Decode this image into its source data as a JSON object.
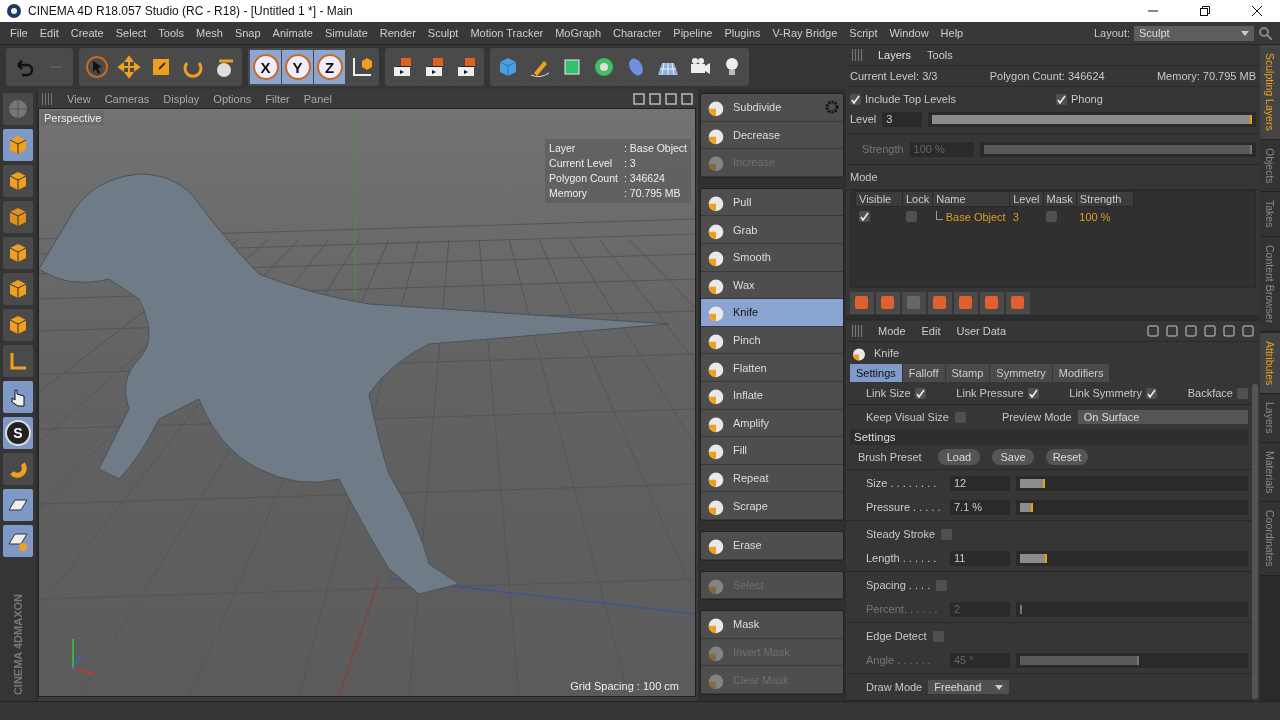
{
  "window": {
    "title": "CINEMA 4D R18.057 Studio (RC - R18) - [Untitled 1 *] - Main"
  },
  "menu": [
    "File",
    "Edit",
    "Create",
    "Select",
    "Tools",
    "Mesh",
    "Snap",
    "Animate",
    "Simulate",
    "Render",
    "Sculpt",
    "Motion Tracker",
    "MoGraph",
    "Character",
    "Pipeline",
    "Plugins",
    "V-Ray Bridge",
    "Script",
    "Window",
    "Help"
  ],
  "layout": {
    "label": "Layout:",
    "value": "Sculpt"
  },
  "axis_buttons": [
    {
      "label": "X",
      "selected": true
    },
    {
      "label": "Y",
      "selected": true
    },
    {
      "label": "Z",
      "selected": true
    }
  ],
  "left_tools": {
    "snap_letter": "S",
    "brand": [
      "MAXON",
      "CINEMA 4D"
    ]
  },
  "viewport": {
    "menu": [
      "View",
      "Cameras",
      "Display",
      "Options",
      "Filter",
      "Panel"
    ],
    "camera": "Perspective",
    "hud": [
      {
        "label": "Layer",
        "value": ": Base Object"
      },
      {
        "label": "Current Level",
        "value": ": 3"
      },
      {
        "label": "Polygon Count",
        "value": ": 346624"
      },
      {
        "label": "Memory",
        "value": ": 70.795 MB"
      }
    ],
    "grid_spacing": "Grid Spacing : 100 cm"
  },
  "palette": [
    [
      {
        "label": "Subdivide",
        "selected": false,
        "disabled": false
      },
      {
        "label": "Decrease",
        "selected": false,
        "disabled": false
      },
      {
        "label": "Increase",
        "selected": false,
        "disabled": true
      }
    ],
    [
      {
        "label": "Pull",
        "selected": false,
        "disabled": false
      },
      {
        "label": "Grab",
        "selected": false,
        "disabled": false
      },
      {
        "label": "Smooth",
        "selected": false,
        "disabled": false
      },
      {
        "label": "Wax",
        "selected": false,
        "disabled": false
      },
      {
        "label": "Knife",
        "selected": true,
        "disabled": false
      },
      {
        "label": "Pinch",
        "selected": false,
        "disabled": false
      },
      {
        "label": "Flatten",
        "selected": false,
        "disabled": false
      },
      {
        "label": "Inflate",
        "selected": false,
        "disabled": false
      },
      {
        "label": "Amplify",
        "selected": false,
        "disabled": false
      },
      {
        "label": "Fill",
        "selected": false,
        "disabled": false
      },
      {
        "label": "Repeat",
        "selected": false,
        "disabled": false
      },
      {
        "label": "Scrape",
        "selected": false,
        "disabled": false
      }
    ],
    [
      {
        "label": "Erase",
        "selected": false,
        "disabled": false
      }
    ],
    [
      {
        "label": "Select",
        "selected": false,
        "disabled": true
      }
    ],
    [
      {
        "label": "Mask",
        "selected": false,
        "disabled": false
      },
      {
        "label": "Invert Mask",
        "selected": false,
        "disabled": true
      },
      {
        "label": "Clear Mask",
        "selected": false,
        "disabled": true
      }
    ]
  ],
  "layers": {
    "tabs": [
      {
        "label": "Layers",
        "selected": true
      },
      {
        "label": "Tools",
        "selected": false
      }
    ],
    "stats": [
      "Current Level: 3/3",
      "Polygon Count: 346624",
      "Memory: 70.795 MB"
    ],
    "options": [
      {
        "label": "Include Top Levels",
        "checked": true
      },
      {
        "label": "Phong",
        "checked": true
      }
    ],
    "level": {
      "label": "Level",
      "value": "3",
      "level": 1.0
    },
    "strength": {
      "label": "Strength",
      "value": "100 %",
      "level": 1.0,
      "disabled": true
    },
    "mode_label": "Mode",
    "columns": [
      "Visible",
      "Lock",
      "Name",
      "Level",
      "Mask",
      "Strength"
    ],
    "rows": [
      {
        "visible": true,
        "lock": false,
        "name": "Base Object",
        "level": "3",
        "mask": false,
        "strength": "100 %"
      }
    ]
  },
  "side_tabs_top": [
    {
      "label": "Sculpting Layers",
      "selected": true
    },
    {
      "label": "Objects",
      "selected": false
    },
    {
      "label": "Takes",
      "selected": false
    },
    {
      "label": "Content Browser",
      "selected": false
    }
  ],
  "side_tabs_bottom": [
    {
      "label": "Attributes",
      "selected": true
    },
    {
      "label": "Layers",
      "selected": false
    },
    {
      "label": "Materials",
      "selected": false
    },
    {
      "label": "Coordinates",
      "selected": false
    }
  ],
  "attributes": {
    "menu": [
      "Mode",
      "Edit",
      "User Data"
    ],
    "object": "Knife",
    "tabs": [
      {
        "label": "Settings",
        "selected": true
      },
      {
        "label": "Falloff",
        "selected": false
      },
      {
        "label": "Stamp",
        "selected": false
      },
      {
        "label": "Symmetry",
        "selected": false
      },
      {
        "label": "Modifiers",
        "selected": false
      }
    ],
    "links": [
      {
        "label": "Link Size",
        "checked": true
      },
      {
        "label": "Link Pressure",
        "checked": true
      },
      {
        "label": "Link Symmetry",
        "checked": true
      },
      {
        "label": "Backface",
        "checked": false
      }
    ],
    "keep_visual_size": {
      "label": "Keep Visual Size",
      "checked": false
    },
    "preview_mode": {
      "label": "Preview Mode",
      "value": "On Surface"
    },
    "section": "Settings",
    "brush_preset": {
      "label": "Brush Preset",
      "buttons": [
        "Load",
        "Save",
        "Reset"
      ]
    },
    "groups": [
      [
        {
          "kind": "slider",
          "label": "Size . . . . . . . .",
          "value": "12",
          "level": 0.11,
          "disabled": false
        },
        {
          "kind": "slider",
          "label": "Pressure . . . . .",
          "value": "7.1 %",
          "level": 0.06,
          "disabled": false
        }
      ],
      [
        {
          "kind": "check",
          "label": "Steady Stroke",
          "checked": false
        },
        {
          "kind": "slider",
          "label": "Length . . . . . .",
          "value": "11",
          "level": 0.12,
          "disabled": false
        }
      ],
      [
        {
          "kind": "check",
          "label": "Spacing . . . .",
          "checked": false
        },
        {
          "kind": "slider",
          "label": "Percent. . . . . .",
          "value": "2",
          "level": 0.01,
          "disabled": true
        }
      ],
      [
        {
          "kind": "check",
          "label": "Edge Detect",
          "checked": false
        },
        {
          "kind": "slider",
          "label": "Angle . . . . . .",
          "value": "45 °",
          "level": 0.53,
          "disabled": true
        }
      ],
      [
        {
          "kind": "dropdown",
          "label": "Draw Mode",
          "value": "Freehand"
        }
      ]
    ]
  }
}
